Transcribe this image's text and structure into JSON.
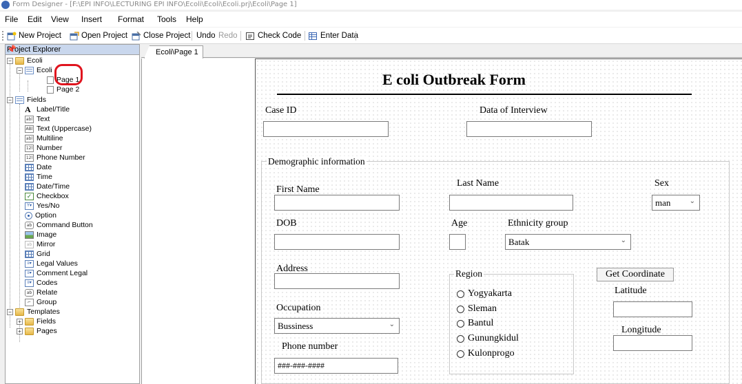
{
  "window": {
    "title": "Form Designer - [F:\\EPI INFO\\LECTURING EPI INFO\\Ecoli\\Ecoli\\Ecoli.prj\\Ecoli\\Page 1]"
  },
  "menu": [
    "File",
    "Edit",
    "View",
    "Insert",
    "Format",
    "Tools",
    "Help"
  ],
  "toolbar": {
    "new_project": "New Project",
    "open_project": "Open Project",
    "close_project": "Close Project",
    "undo": "Undo",
    "redo": "Redo",
    "check_code": "Check Code",
    "enter_data": "Enter Data"
  },
  "explorer": {
    "title": "Project Explorer",
    "pin": "Ⅰ",
    "project": "Ecoli",
    "view": "Ecoli",
    "pages": [
      "Page 1",
      "Page 2"
    ],
    "fields_group": "Fields",
    "fields": [
      "Label/Title",
      "Text",
      "Text (Uppercase)",
      "Multiline",
      "Number",
      "Phone Number",
      "Date",
      "Time",
      "Date/Time",
      "Checkbox",
      "Yes/No",
      "Option",
      "Command Button",
      "Image",
      "Mirror",
      "Grid",
      "Legal Values",
      "Comment Legal",
      "Codes",
      "Relate",
      "Group"
    ],
    "templates_group": "Templates",
    "templates": [
      "Fields",
      "Pages"
    ]
  },
  "tab": {
    "label": "Ecoli\\Page 1"
  },
  "form": {
    "title": "E coli Outbreak Form",
    "case_id_label": "Case ID",
    "case_id_value": "",
    "interview_label": "Data of Interview",
    "interview_value": "",
    "demographic_group": "Demographic information",
    "first_name_label": "First Name",
    "last_name_label": "Last Name",
    "sex_label": "Sex",
    "sex_value": "man",
    "dob_label": "DOB",
    "age_label": "Age",
    "ethnicity_label": "Ethnicity group",
    "ethnicity_value": "Batak",
    "address_label": "Address",
    "region_group": "Region",
    "regions": [
      "Yogyakarta",
      "Sleman",
      "Bantul",
      "Gunungkidul",
      "Kulonprogo"
    ],
    "get_coordinate": "Get Coordinate",
    "latitude_label": "Latitude",
    "longitude_label": "Longitude",
    "occupation_label": "Occupation",
    "occupation_value": "Bussiness",
    "phone_label": "Phone number",
    "phone_value": "###-###-####"
  },
  "colors": {
    "highlight": "#e0141e",
    "header_bg": "#c9d7ed"
  }
}
